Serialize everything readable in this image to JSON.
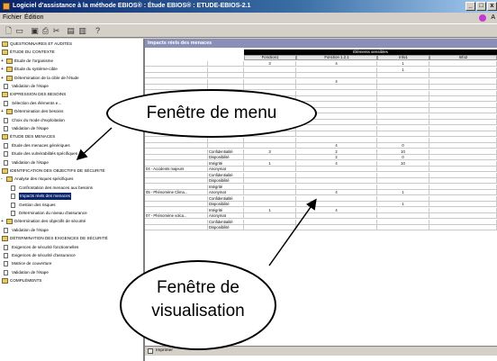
{
  "window": {
    "title": "Logiciel d'assistance à la méthode EBIOS® : Étude EBIOS® : ETUDE-EBIOS-2.1",
    "min_label": "_",
    "max_label": "□",
    "close_label": "x"
  },
  "menubar": {
    "items": [
      "Fichier",
      "Édition"
    ],
    "help": "A"
  },
  "toolbar": {
    "buttons": [
      "new-icon",
      "open-icon",
      "save-icon",
      "print-icon",
      "cut-icon",
      "copy-icon",
      "paste-icon",
      "help-icon"
    ]
  },
  "tree": {
    "items": [
      {
        "label": "QUESTIONNAIRES ET AUDITÉS",
        "level": 0,
        "icon": "folder",
        "expander": ""
      },
      {
        "label": "ÉTUDE DU CONTEXTE",
        "level": 0,
        "icon": "folder",
        "expander": ""
      },
      {
        "label": "Étude de l'organisme",
        "level": 1,
        "icon": "folder",
        "expander": "+"
      },
      {
        "label": "Étude du système-cible",
        "level": 1,
        "icon": "folder",
        "expander": "+"
      },
      {
        "label": "Détermination de la cible de l'étude",
        "level": 1,
        "icon": "folder",
        "expander": "+"
      },
      {
        "label": "Validation de l'étape",
        "level": 1,
        "icon": "doc",
        "expander": ""
      },
      {
        "label": "EXPRESSION DES BESOINS",
        "level": 0,
        "icon": "folder",
        "expander": ""
      },
      {
        "label": "Sélection des éléments e...",
        "level": 1,
        "icon": "doc",
        "expander": ""
      },
      {
        "label": "Détermination des besoins",
        "level": 1,
        "icon": "folder",
        "expander": "+"
      },
      {
        "label": "Choix du mode d'exploitation",
        "level": 1,
        "icon": "doc",
        "expander": ""
      },
      {
        "label": "Validation de l'étape",
        "level": 1,
        "icon": "doc",
        "expander": ""
      },
      {
        "label": "ÉTUDE DES MENACES",
        "level": 0,
        "icon": "folder",
        "expander": ""
      },
      {
        "label": "Étude des menaces génériques",
        "level": 1,
        "icon": "doc",
        "expander": ""
      },
      {
        "label": "Étude des vulnérabilités spécifiques",
        "level": 1,
        "icon": "doc",
        "expander": ""
      },
      {
        "label": "Validation de l'étape",
        "level": 1,
        "icon": "doc",
        "expander": ""
      },
      {
        "label": "IDENTIFICATION DES OBJECTIFS DE SÉCURITÉ",
        "level": 0,
        "icon": "folder",
        "expander": ""
      },
      {
        "label": "Analyse des risques spécifiques",
        "level": 1,
        "icon": "folder",
        "expander": "-"
      },
      {
        "label": "Confrontation des menaces aux besoins",
        "level": 2,
        "icon": "doc",
        "expander": ""
      },
      {
        "label": "Impacts réels des menaces",
        "level": 2,
        "icon": "doc",
        "expander": "",
        "selected": true
      },
      {
        "label": "Gestion des risques",
        "level": 2,
        "icon": "doc",
        "expander": ""
      },
      {
        "label": "Détermination du niveau d'assurance",
        "level": 2,
        "icon": "doc",
        "expander": ""
      },
      {
        "label": "Détermination des objectifs de sécurité",
        "level": 1,
        "icon": "folder",
        "expander": "+"
      },
      {
        "label": "Validation de l'étape",
        "level": 1,
        "icon": "doc",
        "expander": ""
      },
      {
        "label": "DÉTERMINATION DES EXIGENCES DE SÉCURITÉ",
        "level": 0,
        "icon": "folder",
        "expander": ""
      },
      {
        "label": "Exigences de sécurité fonctionnelles",
        "level": 1,
        "icon": "doc",
        "expander": ""
      },
      {
        "label": "Exigences de sécurité d'assurance",
        "level": 1,
        "icon": "doc",
        "expander": ""
      },
      {
        "label": "Matrice de couverture",
        "level": 1,
        "icon": "doc",
        "expander": ""
      },
      {
        "label": "Validation de l'étape",
        "level": 1,
        "icon": "doc",
        "expander": ""
      },
      {
        "label": "COMPLÉMENTS",
        "level": 0,
        "icon": "folder",
        "expander": ""
      }
    ]
  },
  "main": {
    "title": "Impacts réels des menaces",
    "group_header": "Éléments sensibles",
    "columns": [
      "Fonction1",
      "Fonction 1.2.1",
      "Info1",
      "Info2"
    ],
    "rows": [
      {
        "menace": "",
        "critere": "",
        "values": [
          "3",
          "4",
          "1",
          ""
        ]
      },
      {
        "menace": "",
        "critere": "",
        "values": [
          "",
          "",
          "1",
          ""
        ]
      },
      {
        "menace": "",
        "critere": "",
        "values": [
          "",
          "",
          "",
          ""
        ]
      },
      {
        "menace": "",
        "critere": "",
        "values": [
          "",
          "4",
          "",
          ""
        ]
      },
      {
        "menace": "",
        "critere": "",
        "values": [
          "",
          "",
          "",
          ""
        ]
      },
      {
        "menace": "",
        "critere": "",
        "values": [
          "",
          "",
          "",
          ""
        ]
      },
      {
        "menace": "",
        "critere": "",
        "values": [
          "",
          "",
          "",
          ""
        ]
      },
      {
        "menace": "",
        "critere": "",
        "values": [
          "",
          "",
          "",
          ""
        ]
      },
      {
        "menace": "",
        "critere": "",
        "values": [
          "",
          "",
          "",
          ""
        ]
      },
      {
        "menace": "",
        "critere": "",
        "values": [
          "",
          "",
          "",
          ""
        ]
      },
      {
        "menace": "",
        "critere": "",
        "values": [
          "",
          "",
          "",
          ""
        ]
      },
      {
        "menace": "",
        "critere": "",
        "values": [
          "",
          "",
          "",
          ""
        ]
      },
      {
        "menace": "",
        "critere": "",
        "values": [
          "",
          "",
          "",
          ""
        ]
      },
      {
        "menace": "",
        "critere": "",
        "values": [
          "",
          "",
          "",
          ""
        ]
      },
      {
        "menace": "",
        "critere": "",
        "values": [
          "",
          "4",
          "0",
          ""
        ]
      },
      {
        "menace": "",
        "critere": "Confidentialité",
        "values": [
          "3",
          "2",
          "10",
          ""
        ]
      },
      {
        "menace": "",
        "critere": "Disponibilité",
        "values": [
          "",
          "2",
          "0",
          ""
        ]
      },
      {
        "menace": "",
        "critere": "Intégrité",
        "values": [
          "1",
          "4",
          "10",
          ""
        ]
      },
      {
        "menace": "04 - Accidents majeurs",
        "critere": "Anonymat",
        "values": [
          "",
          "",
          "",
          ""
        ]
      },
      {
        "menace": "",
        "critere": "Confidentialité",
        "values": [
          "",
          "",
          "",
          ""
        ]
      },
      {
        "menace": "",
        "critere": "Disponibilité",
        "values": [
          "",
          "",
          "",
          ""
        ]
      },
      {
        "menace": "",
        "critere": "Intégrité",
        "values": [
          "",
          "",
          "",
          ""
        ]
      },
      {
        "menace": "05 - Phénomène Clima...",
        "critere": "Anonymat",
        "values": [
          "",
          "4",
          "1",
          ""
        ]
      },
      {
        "menace": "",
        "critere": "Confidentialité",
        "values": [
          "",
          "",
          "",
          ""
        ]
      },
      {
        "menace": "",
        "critere": "Disponibilité",
        "values": [
          "",
          "",
          "1",
          ""
        ]
      },
      {
        "menace": "",
        "critere": "Intégrité",
        "values": [
          "1",
          "4",
          "",
          ""
        ]
      },
      {
        "menace": "07 - Phénomène volca...",
        "critere": "Anonymat",
        "values": [
          "",
          "",
          "",
          ""
        ]
      },
      {
        "menace": "",
        "critere": "Confidentialité",
        "values": [
          "",
          "",
          "",
          ""
        ]
      },
      {
        "menace": "",
        "critere": "Disponibilité",
        "values": [
          "",
          "",
          "",
          ""
        ]
      }
    ],
    "status_print": "Imprimer"
  },
  "callouts": {
    "menu": "Fenêtre de menu",
    "view_line1": "Fenêtre de",
    "view_line2": "visualisation"
  },
  "colors": {
    "title_gradient_start": "#0a246a",
    "panel_header": "#8a8fb8",
    "selection": "#0a246a",
    "chrome": "#d4d0c8"
  }
}
